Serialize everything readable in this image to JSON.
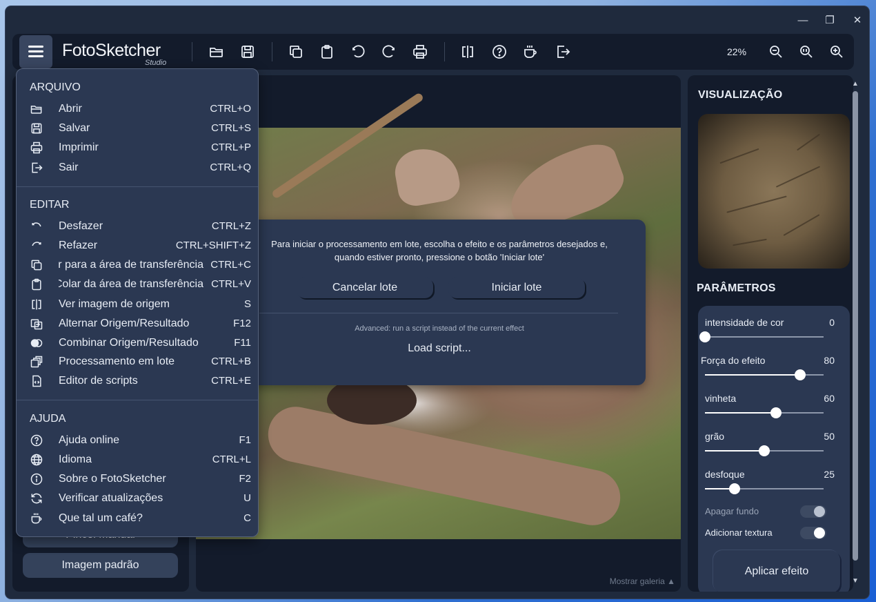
{
  "window": {
    "controls": {
      "minimize": "—",
      "restore": "❐",
      "close": "✕"
    }
  },
  "toolbar": {
    "logo": "FotoSketcher",
    "logo_sub": "Studio",
    "zoom": "22%"
  },
  "left_panel": {
    "hidden_button": "Pincel Manual",
    "default_image_button": "Imagem padrão"
  },
  "canvas": {
    "gallery_toggle": "Mostrar galeria ▲"
  },
  "batch": {
    "message_line1": "Para iniciar o processamento em lote, escolha o efeito e os parâmetros desejados e,",
    "message_line2": "quando estiver pronto, pressione o botão 'Iniciar lote'",
    "cancel_label": "Cancelar lote",
    "start_label": "Iniciar lote",
    "advanced_note": "Advanced: run a script instead of the current effect",
    "load_script": "Load script..."
  },
  "right_panel": {
    "preview_heading": "VISUALIZAÇÃO",
    "params_heading": "PARÂMETROS",
    "params": [
      {
        "label": "intensidade de cor",
        "value": "0",
        "fraction": 0.0
      },
      {
        "label": "Força do efeito",
        "value": "80",
        "fraction": 0.8
      },
      {
        "label": "vinheta",
        "value": "60",
        "fraction": 0.6
      },
      {
        "label": "grão",
        "value": "50",
        "fraction": 0.5
      },
      {
        "label": "desfoque",
        "value": "25",
        "fraction": 0.25
      }
    ],
    "toggles": [
      {
        "label": "Apagar fundo",
        "on": false
      },
      {
        "label": "Adicionar textura",
        "on": true
      }
    ],
    "apply_label": "Aplicar efeito"
  },
  "menu": {
    "sections": [
      {
        "title": "ARQUIVO",
        "items": [
          {
            "icon": "folder-open-icon",
            "label": "Abrir",
            "shortcut": "CTRL+O"
          },
          {
            "icon": "save-icon",
            "label": "Salvar",
            "shortcut": "CTRL+S"
          },
          {
            "icon": "print-icon",
            "label": "Imprimir",
            "shortcut": "CTRL+P"
          },
          {
            "icon": "exit-icon",
            "label": "Sair",
            "shortcut": "CTRL+Q"
          }
        ]
      },
      {
        "title": "EDITAR",
        "items": [
          {
            "icon": "undo-icon",
            "label": "Desfazer",
            "shortcut": "CTRL+Z"
          },
          {
            "icon": "redo-icon",
            "label": "Refazer",
            "shortcut": "CTRL+SHIFT+Z"
          },
          {
            "icon": "copy-icon",
            "label": "Copiar para a área de transferência",
            "shortcut": "CTRL+C"
          },
          {
            "icon": "paste-icon",
            "label": "Colar da área de transferência",
            "shortcut": "CTRL+V"
          },
          {
            "icon": "compare-icon",
            "label": "Ver imagem de origem",
            "shortcut": "S"
          },
          {
            "icon": "swap-icon",
            "label": "Alternar Origem/Resultado",
            "shortcut": "F12"
          },
          {
            "icon": "blend-icon",
            "label": "Combinar Origem/Resultado",
            "shortcut": "F11"
          },
          {
            "icon": "batch-icon",
            "label": "Processamento em lote",
            "shortcut": "CTRL+B"
          },
          {
            "icon": "script-icon",
            "label": "Editor de scripts",
            "shortcut": "CTRL+E"
          }
        ]
      },
      {
        "title": "AJUDA",
        "items": [
          {
            "icon": "help-icon",
            "label": "Ajuda online",
            "shortcut": "F1"
          },
          {
            "icon": "globe-icon",
            "label": "Idioma",
            "shortcut": "CTRL+L"
          },
          {
            "icon": "info-icon",
            "label": "Sobre o FotoSketcher",
            "shortcut": "F2"
          },
          {
            "icon": "refresh-icon",
            "label": "Verificar atualizações",
            "shortcut": "U"
          },
          {
            "icon": "coffee-icon",
            "label": "Que tal um café?",
            "shortcut": "C"
          }
        ]
      }
    ]
  }
}
